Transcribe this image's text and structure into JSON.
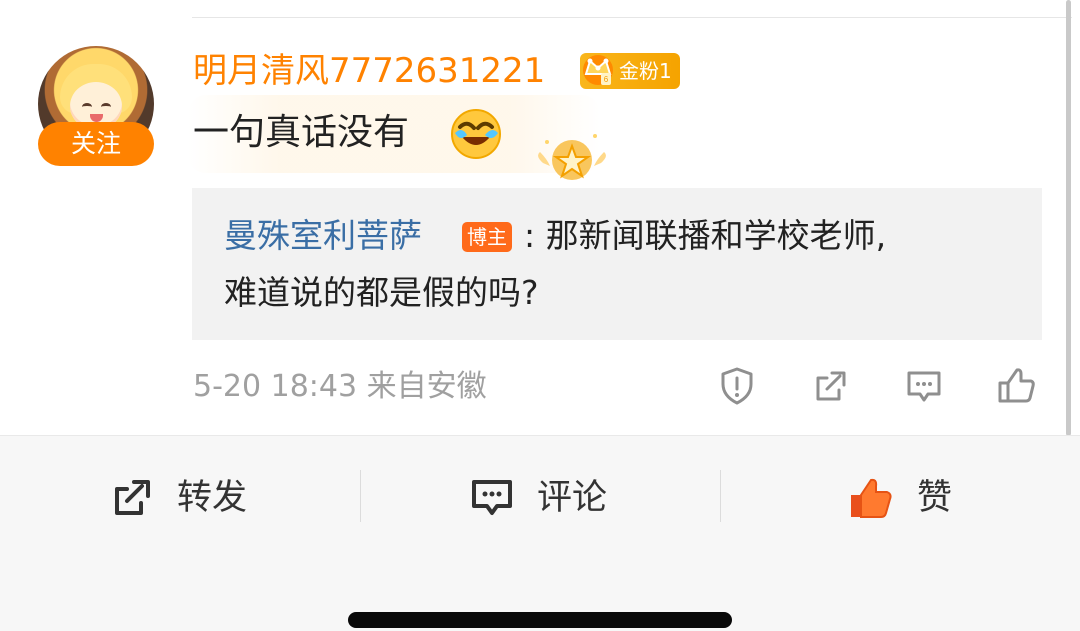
{
  "comment": {
    "avatar_label": "avatar",
    "follow_label": "关注",
    "username": "明月清风7772631221",
    "fan_badge": "金粉1",
    "text": "一句真话没有"
  },
  "reply": {
    "author": "曼殊室利菩萨",
    "blogger_badge": "博主",
    "line1": ": 那新闻联播和学校老师,",
    "line2": "难道说的都是假的吗?"
  },
  "meta": {
    "timestamp": "5-20 18:43 来自安徽"
  },
  "tabbar": {
    "repost_label": "转发",
    "comment_label": "评论",
    "like_label": "赞"
  },
  "colors": {
    "accent_orange": "#ff8200",
    "link_blue": "#3a6ea5",
    "muted_gray": "#a0a0a0",
    "text_dark": "#222222"
  },
  "icons": {
    "avatar": "avatar",
    "fan": "crown-icon",
    "emoji": "laugh-cry-icon",
    "medal": "star-medal-icon",
    "report": "shield-alert-icon",
    "share": "share-icon",
    "comment": "comment-icon",
    "like": "thumb-up-icon"
  }
}
